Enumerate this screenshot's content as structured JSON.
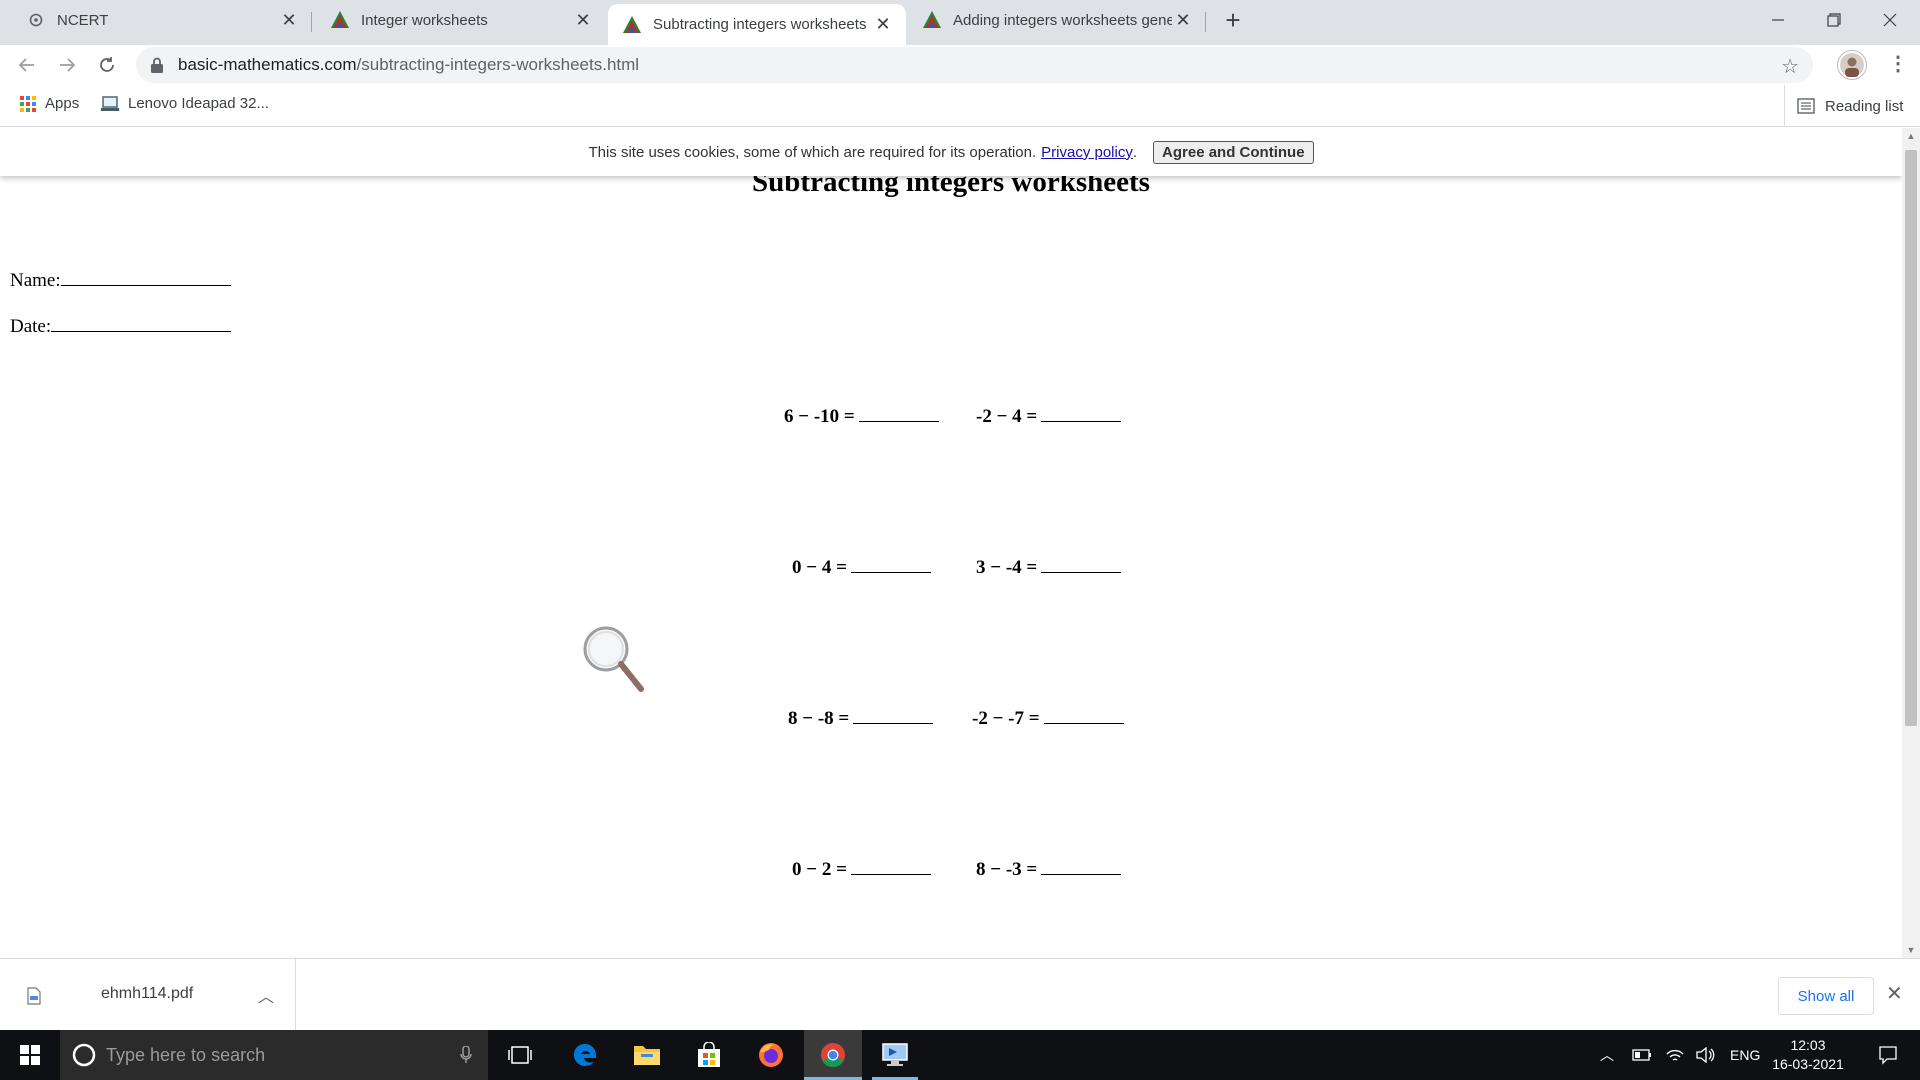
{
  "browser": {
    "tabs": [
      {
        "title": "NCERT",
        "active": false
      },
      {
        "title": "Integer worksheets",
        "active": false
      },
      {
        "title": "Subtracting integers worksheets",
        "active": true
      },
      {
        "title": "Adding integers worksheets genera",
        "active": false
      }
    ],
    "new_tab": "+",
    "url_domain": "basic-mathematics.com",
    "url_path": "/subtracting-integers-worksheets.html",
    "bookmarks": [
      {
        "label": "Apps"
      },
      {
        "label": "Lenovo Ideapad 32..."
      }
    ],
    "reading_list": "Reading list"
  },
  "cookie_banner": {
    "text": "This site uses cookies, some of which are required for its operation.",
    "link": "Privacy policy",
    "period": ".",
    "button": "Agree and Continue"
  },
  "page": {
    "title": "Subtracting integers worksheets",
    "name_label": "Name:",
    "date_label": "Date:",
    "problems": [
      "6 − -10 =",
      "-2 − 4 =",
      "0 − 4 =",
      "3 − -4 =",
      "8 − -8 =",
      "-2 − -7 =",
      "0 − 2 =",
      "8 − -3 ="
    ]
  },
  "downloads": {
    "file": "ehmh114.pdf",
    "show_all": "Show all"
  },
  "taskbar": {
    "search_placeholder": "Type here to search",
    "language": "ENG",
    "time": "12:03",
    "date": "16-03-2021"
  }
}
